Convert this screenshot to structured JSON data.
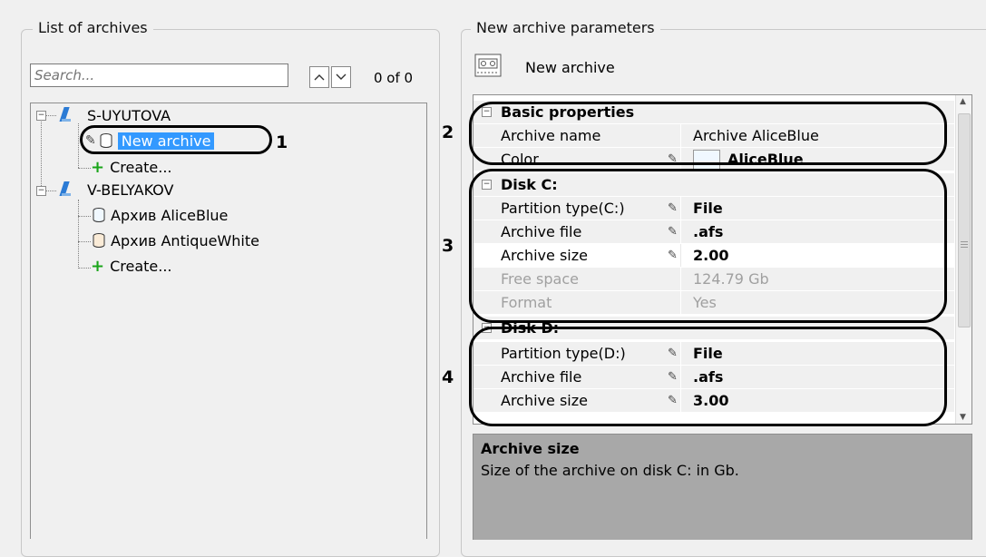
{
  "left_panel": {
    "title": "List of archives",
    "search": {
      "placeholder": "Search...",
      "value": ""
    },
    "counter": "0 of 0",
    "tree": {
      "server1": {
        "label": "S-UYUTOVA",
        "children": {
          "archive": "New archive",
          "create": "Create..."
        }
      },
      "server2": {
        "label": "V-BELYAKOV",
        "children": {
          "archive1": "Архив AliceBlue",
          "archive2": "Архив AntiqueWhite",
          "create": "Create..."
        }
      }
    }
  },
  "right_panel": {
    "title": "New archive parameters",
    "header_label": "New archive",
    "sections": {
      "basic": {
        "title": "Basic properties",
        "archive_name": {
          "name": "Archive name",
          "value": "Archive AliceBlue"
        },
        "color": {
          "name": "Color",
          "value": "AliceBlue",
          "swatch": "#f0f8ff"
        }
      },
      "disk_c": {
        "title": "Disk C:",
        "partition_type": {
          "name": "Partition type(C:)",
          "value": "File"
        },
        "archive_file": {
          "name": "Archive file",
          "value": ".afs"
        },
        "archive_size": {
          "name": "Archive size",
          "value": "2.00"
        },
        "free_space": {
          "name": "Free space",
          "value": "124.79 Gb"
        },
        "format": {
          "name": "Format",
          "value": "Yes"
        }
      },
      "disk_d": {
        "title": "Disk D:",
        "partition_type": {
          "name": "Partition type(D:)",
          "value": "File"
        },
        "archive_file": {
          "name": "Archive file",
          "value": ".afs"
        },
        "archive_size": {
          "name": "Archive size",
          "value": "3.00"
        }
      }
    },
    "help": {
      "title": "Archive size",
      "text": "Size of the archive on disk C: in Gb."
    }
  },
  "callouts": {
    "c1": "1",
    "c2": "2",
    "c3": "3",
    "c4": "4"
  }
}
